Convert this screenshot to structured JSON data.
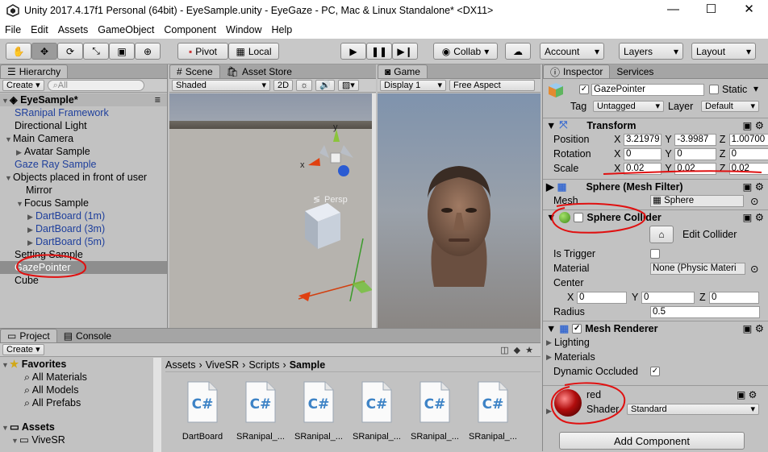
{
  "window": {
    "title": "Unity 2017.4.17f1 Personal (64bit) - EyeSample.unity - EyeGaze - PC, Mac & Linux Standalone* <DX11>",
    "minimize": "—",
    "maximize": "☐",
    "close": "✕"
  },
  "menu": [
    "File",
    "Edit",
    "Assets",
    "GameObject",
    "Component",
    "Window",
    "Help"
  ],
  "toolbar": {
    "pivot": "Pivot",
    "local": "Local",
    "collab": "Collab",
    "account": "Account",
    "layers": "Layers",
    "layout": "Layout"
  },
  "hierarchy": {
    "tab": "Hierarchy",
    "create": "Create",
    "search_placeholder": "All",
    "scene": "EyeSample*",
    "items": [
      {
        "label": "SRanipal Framework",
        "indent": 1,
        "blue": true,
        "arrow": ""
      },
      {
        "label": "Directional Light",
        "indent": 1,
        "blue": false,
        "arrow": ""
      },
      {
        "label": "Main Camera",
        "indent": 1,
        "blue": false,
        "arrow": "▼"
      },
      {
        "label": "Avatar Sample",
        "indent": 2,
        "blue": false,
        "arrow": "▶"
      },
      {
        "label": "Gaze Ray Sample",
        "indent": 1,
        "blue": true,
        "arrow": ""
      },
      {
        "label": "Objects placed in front of user",
        "indent": 1,
        "blue": false,
        "arrow": "▼"
      },
      {
        "label": "Mirror",
        "indent": 2,
        "blue": false,
        "arrow": ""
      },
      {
        "label": "Focus Sample",
        "indent": 2,
        "blue": false,
        "arrow": "▼"
      },
      {
        "label": "DartBoard (1m)",
        "indent": 3,
        "blue": true,
        "arrow": "▶"
      },
      {
        "label": "DartBoard (3m)",
        "indent": 3,
        "blue": true,
        "arrow": "▶"
      },
      {
        "label": "DartBoard (5m)",
        "indent": 3,
        "blue": true,
        "arrow": "▶"
      },
      {
        "label": "Setting Sample",
        "indent": 1,
        "blue": false,
        "arrow": ""
      },
      {
        "label": "GazePointer",
        "indent": 1,
        "blue": false,
        "arrow": "",
        "selected": true
      },
      {
        "label": "Cube",
        "indent": 1,
        "blue": false,
        "arrow": ""
      }
    ]
  },
  "scene": {
    "tab": "Scene",
    "asset_store": "Asset Store",
    "shading": "Shaded",
    "mode_2d": "2D",
    "persp": "Persp",
    "axis_x": "x",
    "axis_y": "y"
  },
  "game": {
    "tab": "Game",
    "display": "Display 1",
    "aspect": "Free Aspect"
  },
  "project": {
    "tab": "Project",
    "console": "Console",
    "create": "Create",
    "favorites": "Favorites",
    "fav_items": [
      "All Materials",
      "All Models",
      "All Prefabs"
    ],
    "assets": "Assets",
    "assets_child": "ViveSR",
    "breadcrumb": [
      "Assets",
      "ViveSR",
      "Scripts",
      "Sample"
    ],
    "files": [
      "DartBoard",
      "SRanipal_...",
      "SRanipal_...",
      "SRanipal_...",
      "SRanipal_...",
      "SRanipal_..."
    ]
  },
  "inspector": {
    "tab": "Inspector",
    "services": "Services",
    "name": "GazePointer",
    "static": "Static",
    "tag_label": "Tag",
    "tag": "Untagged",
    "layer_label": "Layer",
    "layer": "Default",
    "transform": {
      "title": "Transform",
      "position": "Position",
      "rotation": "Rotation",
      "scale": "Scale",
      "pos": [
        "3.21979",
        "-3.9987",
        "1.00700"
      ],
      "rot": [
        "0",
        "0",
        "0"
      ],
      "scl": [
        "0.02",
        "0.02",
        "0.02"
      ]
    },
    "mesh_filter": {
      "title": "Sphere (Mesh Filter)",
      "mesh_label": "Mesh",
      "mesh": "Sphere"
    },
    "collider": {
      "title": "Sphere Collider",
      "edit": "Edit Collider",
      "is_trigger": "Is Trigger",
      "material_label": "Material",
      "material": "None (Physic Materi",
      "center": "Center",
      "center_vals": [
        "0",
        "0",
        "0"
      ],
      "radius_label": "Radius",
      "radius": "0.5"
    },
    "renderer": {
      "title": "Mesh Renderer",
      "lighting": "Lighting",
      "materials": "Materials",
      "dynamic": "Dynamic Occluded"
    },
    "material": {
      "name": "red",
      "shader_label": "Shader",
      "shader": "Standard"
    },
    "add_component": "Add Component"
  },
  "colors": {
    "annotation": "#e01010",
    "link": "#1e3f9c",
    "selected": "#8e8e8e"
  }
}
